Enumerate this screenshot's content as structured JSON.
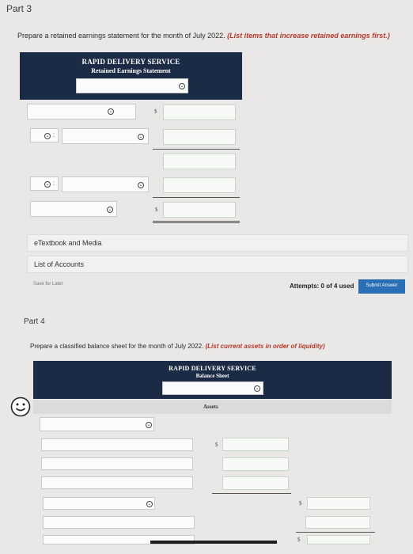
{
  "part3": {
    "title": "Part 3",
    "instruction_plain": "Prepare a retained earnings statement for the month of July 2022. ",
    "instruction_em": "(List items that increase retained earnings first.)",
    "header_company": "RAPID DELIVERY SERVICE",
    "header_statement": "Retained Earnings Statement"
  },
  "currency_symbol": "$",
  "links": {
    "etextbook": "eTextbook and Media",
    "accounts": "List of Accounts"
  },
  "actions": {
    "save_later": "Save for Later",
    "attempts": "Attempts: 0 of 4 used",
    "submit": "Submit Answer"
  },
  "part4": {
    "title": "Part 4",
    "instruction_plain": "Prepare a classified balance sheet for the month of July 2022. ",
    "instruction_em": "(List current assets in order of liquidity)",
    "header_company": "RAPID DELIVERY SERVICE",
    "header_statement": "Balance Sheet",
    "section_label": "Assets"
  },
  "icons": {
    "dropdown": "chevron-circle-icon",
    "hint": "smiley-icon"
  }
}
